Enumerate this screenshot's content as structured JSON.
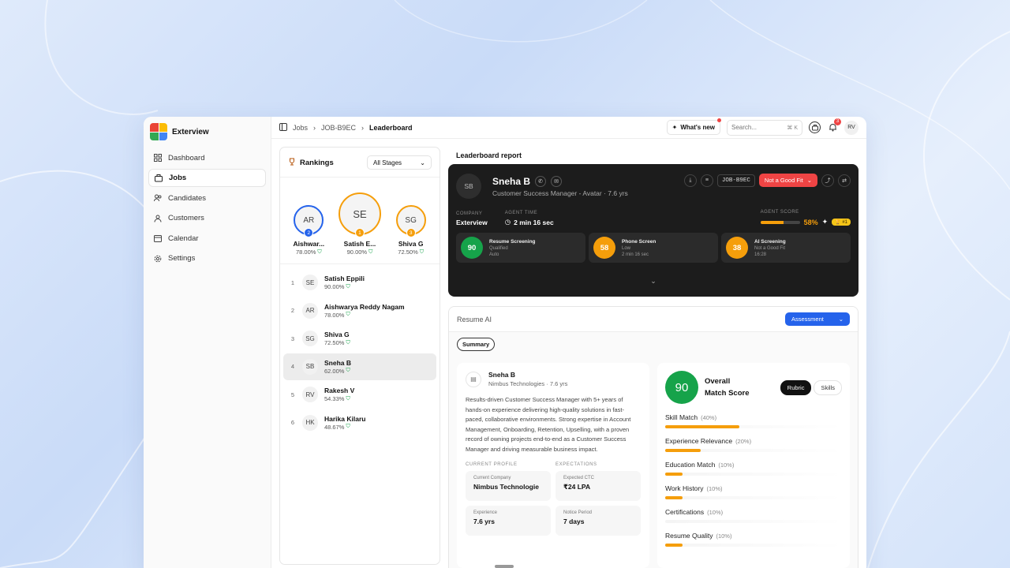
{
  "brand": {
    "name": "Exterview",
    "logo_colors": [
      "#ea4335",
      "#fbbc05",
      "#34a853",
      "#4285f4"
    ]
  },
  "sidebar": {
    "items": [
      {
        "label": "Dashboard",
        "icon": "grid-icon"
      },
      {
        "label": "Jobs",
        "icon": "briefcase-icon",
        "active": true
      },
      {
        "label": "Candidates",
        "icon": "users-icon"
      },
      {
        "label": "Customers",
        "icon": "customer-icon"
      },
      {
        "label": "Calendar",
        "icon": "calendar-icon"
      },
      {
        "label": "Settings",
        "icon": "gear-icon"
      }
    ]
  },
  "breadcrumb": {
    "items": [
      "Jobs",
      "JOB-B9EC",
      "Leaderboard"
    ]
  },
  "topbar": {
    "whats_new": "What's new",
    "search_placeholder": "Search...",
    "search_shortcut": "⌘ K",
    "notif_count": "3",
    "user_initials": "RV"
  },
  "rankings": {
    "title": "Rankings",
    "stage_filter": "All Stages",
    "podium": [
      {
        "initials": "AR",
        "rank": "2",
        "name": "Aishwarya Reddy Nagam",
        "short": "Aishwar...",
        "score": "78.00%",
        "color": "#2563eb"
      },
      {
        "initials": "SE",
        "rank": "1",
        "name": "Satish Eppili",
        "short": "Satish E...",
        "score": "90.00%",
        "color": "#f59e0b"
      },
      {
        "initials": "SG",
        "rank": "3",
        "name": "Shiva G",
        "short": "Shiva G",
        "score": "72.50%",
        "color": "#f59e0b"
      }
    ],
    "list": [
      {
        "rank": "1",
        "initials": "SE",
        "name": "Satish Eppili",
        "score": "90.00%"
      },
      {
        "rank": "2",
        "initials": "AR",
        "name": "Aishwarya Reddy Nagam",
        "score": "78.00%"
      },
      {
        "rank": "3",
        "initials": "SG",
        "name": "Shiva G",
        "score": "72.50%"
      },
      {
        "rank": "4",
        "initials": "SB",
        "name": "Sneha B",
        "score": "62.00%",
        "selected": true
      },
      {
        "rank": "5",
        "initials": "RV",
        "name": "Rakesh V",
        "score": "54.33%"
      },
      {
        "rank": "6",
        "initials": "HK",
        "name": "Harika Kilaru",
        "score": "48.67%"
      }
    ]
  },
  "report": {
    "title": "Leaderboard report",
    "candidate": {
      "initials": "SB",
      "name": "Sneha B",
      "role": "Customer Success Manager - Avatar · 7.6 yrs",
      "job_id": "JOB-B9EC",
      "status": "Not a Good Fit",
      "company_label": "COMPANY",
      "company": "Exterview",
      "agent_time_label": "AGENT TIME",
      "agent_time": "2 min 16 sec",
      "agent_score_label": "AGENT SCORE",
      "agent_score": "58%",
      "agent_score_fraction": 0.58,
      "rank_chip": "#1"
    },
    "stages": [
      {
        "score": "90",
        "title": "Resume Screening",
        "sub1": "Qualified",
        "sub2": "Auto",
        "color": "#16a34a"
      },
      {
        "score": "58",
        "title": "Phone Screen",
        "sub1": "Low",
        "sub2": "2 min 16 sec",
        "color": "#f59e0b"
      },
      {
        "score": "38",
        "title": "AI Screening",
        "sub1": "Not a Good Fit",
        "sub2": "16:28",
        "color": "#f59e0b"
      }
    ]
  },
  "resume_ai": {
    "label": "Resume AI",
    "mode": "Assessment",
    "summary_tab": "Summary",
    "profile": {
      "name": "Sneha B",
      "company_line": "Nimbus Technologies · 7.6 yrs",
      "summary": "Results-driven Customer Success Manager with 5+ years of hands-on experience delivering high-quality solutions in fast-paced, collaborative environments. Strong expertise in Account Management, Onboarding, Retention, Upselling, with a proven record of owning projects end-to-end as a Customer Success Manager and driving measurable business impact.",
      "current_profile_label": "CURRENT PROFILE",
      "expectations_label": "EXPECTATIONS",
      "fields": [
        {
          "label": "Current Company",
          "value": "Nimbus Technologie"
        },
        {
          "label": "Expected CTC",
          "value": "₹24 LPA"
        },
        {
          "label": "Experience",
          "value": "7.6 yrs"
        },
        {
          "label": "Notice Period",
          "value": "7 days"
        }
      ]
    },
    "match": {
      "score": "90",
      "title_line1": "Overall",
      "title_line2": "Match Score",
      "tabs": [
        "Rubric",
        "Skills"
      ],
      "criteria": [
        {
          "label": "Skill Match",
          "weight": "(40%)",
          "fill": 0.42
        },
        {
          "label": "Experience Relevance",
          "weight": "(20%)",
          "fill": 0.2
        },
        {
          "label": "Education Match",
          "weight": "(10%)",
          "fill": 0.1
        },
        {
          "label": "Work History",
          "weight": "(10%)",
          "fill": 0.1
        },
        {
          "label": "Certifications",
          "weight": "(10%)",
          "fill": 0
        },
        {
          "label": "Resume Quality",
          "weight": "(10%)",
          "fill": 0.1
        }
      ]
    }
  }
}
